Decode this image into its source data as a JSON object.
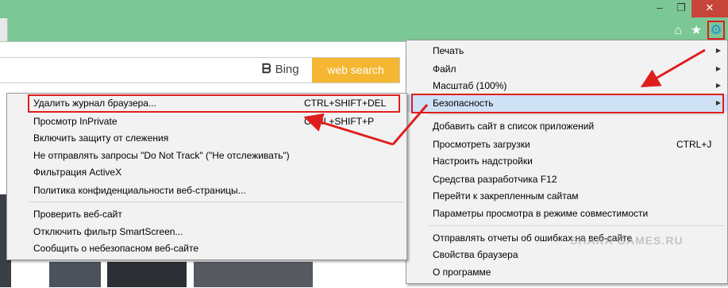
{
  "window_controls": {
    "minimize": "–",
    "maximize": "❐",
    "close": "✕"
  },
  "toolbar": {
    "home_icon": "⌂",
    "star_icon": "★",
    "gear_icon": "⚙"
  },
  "search": {
    "bing_label": "Bing",
    "button": "web search"
  },
  "main_menu": {
    "items": [
      {
        "label": "Печать",
        "shortcut": "",
        "submenu": true
      },
      {
        "label": "Файл",
        "shortcut": "",
        "submenu": true
      },
      {
        "label": "Масштаб (100%)",
        "shortcut": "",
        "submenu": true
      },
      {
        "label": "Безопасность",
        "shortcut": "",
        "submenu": true,
        "highlighted": true
      },
      {
        "label": "Добавить сайт в список приложений",
        "shortcut": ""
      },
      {
        "label": "Просмотреть загрузки",
        "shortcut": "CTRL+J"
      },
      {
        "label": "Настроить надстройки",
        "shortcut": ""
      },
      {
        "label": "Средства разработчика F12",
        "shortcut": ""
      },
      {
        "label": "Перейти к закрепленным сайтам",
        "shortcut": ""
      },
      {
        "label": "Параметры просмотра в режиме совместимости",
        "shortcut": ""
      },
      {
        "label": "Отправлять отчеты об ошибках на веб-сайте",
        "shortcut": ""
      },
      {
        "label": "Свойства браузера",
        "shortcut": ""
      },
      {
        "label": "О программе",
        "shortcut": ""
      }
    ]
  },
  "security_menu": {
    "items": [
      {
        "label": "Удалить журнал браузера...",
        "shortcut": "CTRL+SHIFT+DEL"
      },
      {
        "label": "Просмотр InPrivate",
        "shortcut": "CTRL+SHIFT+P"
      },
      {
        "label": "Включить защиту от слежения",
        "shortcut": ""
      },
      {
        "label": "Не отправлять запросы \"Do Not Track\" (\"Не отслеживать\")",
        "shortcut": ""
      },
      {
        "label": "Фильтрация ActiveX",
        "shortcut": ""
      },
      {
        "label": "Политика конфиденциальности веб-страницы...",
        "shortcut": ""
      },
      {
        "label": "Проверить веб-сайт",
        "shortcut": ""
      },
      {
        "label": "Отключить фильтр SmartScreen...",
        "shortcut": ""
      },
      {
        "label": "Сообщить о небезопасном веб-сайте",
        "shortcut": ""
      }
    ]
  },
  "watermark": "SHARA GAMES.RU",
  "colors": {
    "frame": "#7cc796",
    "accent": "#f5b632",
    "highlight": "#cfe1f5",
    "annotation": "#e01d1d"
  }
}
